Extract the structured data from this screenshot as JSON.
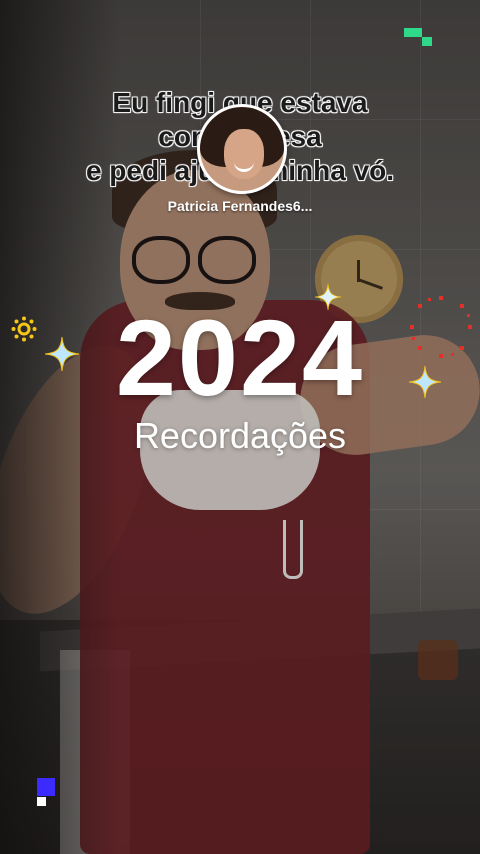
{
  "caption": {
    "lines": [
      "Eu fingi que estava",
      "com a    presa",
      "e pedi ajud     a minha vó."
    ]
  },
  "profile": {
    "name": "Patricia Fernandes6..."
  },
  "recap": {
    "year": "2024",
    "subtitle": "Recordações"
  },
  "colors": {
    "accent_green": "#2ed98a",
    "accent_blue": "#3b2bff",
    "sparkle": "#bfe6ff",
    "gold": "#f5c518",
    "red": "#e0312a"
  },
  "icons": [
    "sparkle-icon",
    "sun-burst-icon",
    "firework-ring-icon",
    "green-pixel-icon",
    "blue-pixel-icon"
  ]
}
